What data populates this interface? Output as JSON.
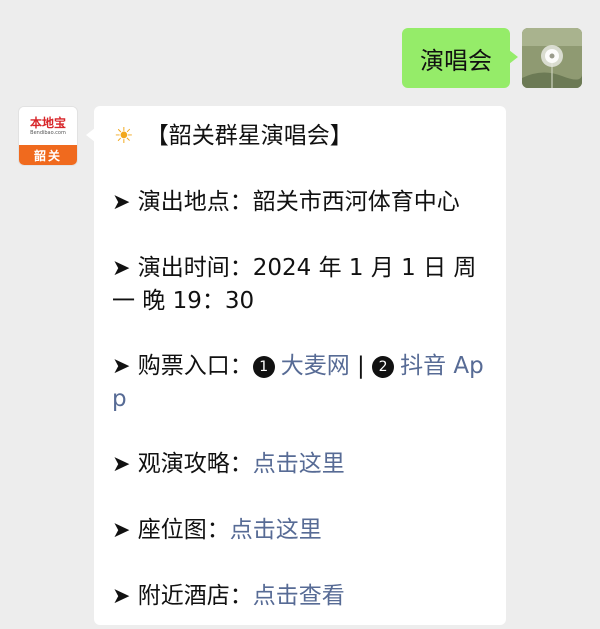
{
  "outgoing": {
    "text": "演唱会"
  },
  "incoming": {
    "avatar": {
      "brand": "本地宝",
      "domain": "Bendibao.com",
      "city": "韶关"
    },
    "title_icon": "sun-icon",
    "title": "【韶关群星演唱会】",
    "arrow": "➤",
    "venue": {
      "label": "演出地点：",
      "value": "韶关市西河体育中心"
    },
    "time": {
      "label": "演出时间：",
      "value": "2024 年 1 月 1 日 周一 晚 19：30"
    },
    "tickets": {
      "label": "购票入口：",
      "badge1": "1",
      "link1": "大麦网",
      "separator": " | ",
      "badge2": "2",
      "link2": "抖音 App"
    },
    "guide": {
      "label": "观演攻略：",
      "link": "点击这里"
    },
    "seating": {
      "label": "座位图：",
      "link": "点击这里"
    },
    "hotels": {
      "label": "附近酒店：",
      "link": "点击查看"
    }
  },
  "colors": {
    "background": "#ededed",
    "outgoing_bubble": "#95ec69",
    "incoming_bubble": "#ffffff",
    "link": "#576b95",
    "app_brand_red": "#d8262a",
    "app_city_orange": "#f06a1e"
  }
}
